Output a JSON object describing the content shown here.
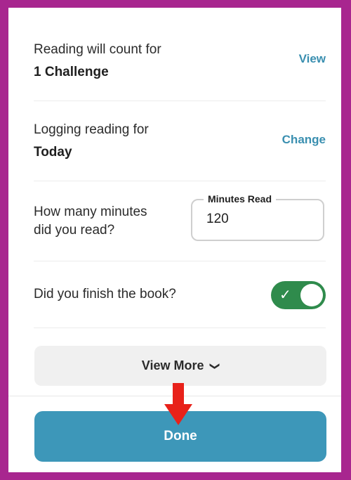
{
  "challenge": {
    "label": "Reading will count for",
    "value": "1 Challenge",
    "action": "View"
  },
  "logging": {
    "label": "Logging reading for",
    "value": "Today",
    "action": "Change"
  },
  "minutes": {
    "question_line1": "How many minutes",
    "question_line2": "did you read?",
    "field_label": "Minutes Read",
    "field_value": "120"
  },
  "finished": {
    "question": "Did you finish the book?",
    "toggle_on": true
  },
  "view_more": {
    "label": "View More"
  },
  "done": {
    "label": "Done"
  },
  "colors": {
    "frame": "#a8268f",
    "accent_blue": "#3d97b9",
    "link_blue": "#3a8fb0",
    "toggle_green": "#2f8b4c",
    "arrow_red": "#e8211a"
  },
  "icons": {
    "toggle": "check-icon",
    "view_more": "chevron-down-icon",
    "annotation": "red-arrow-down-icon"
  }
}
